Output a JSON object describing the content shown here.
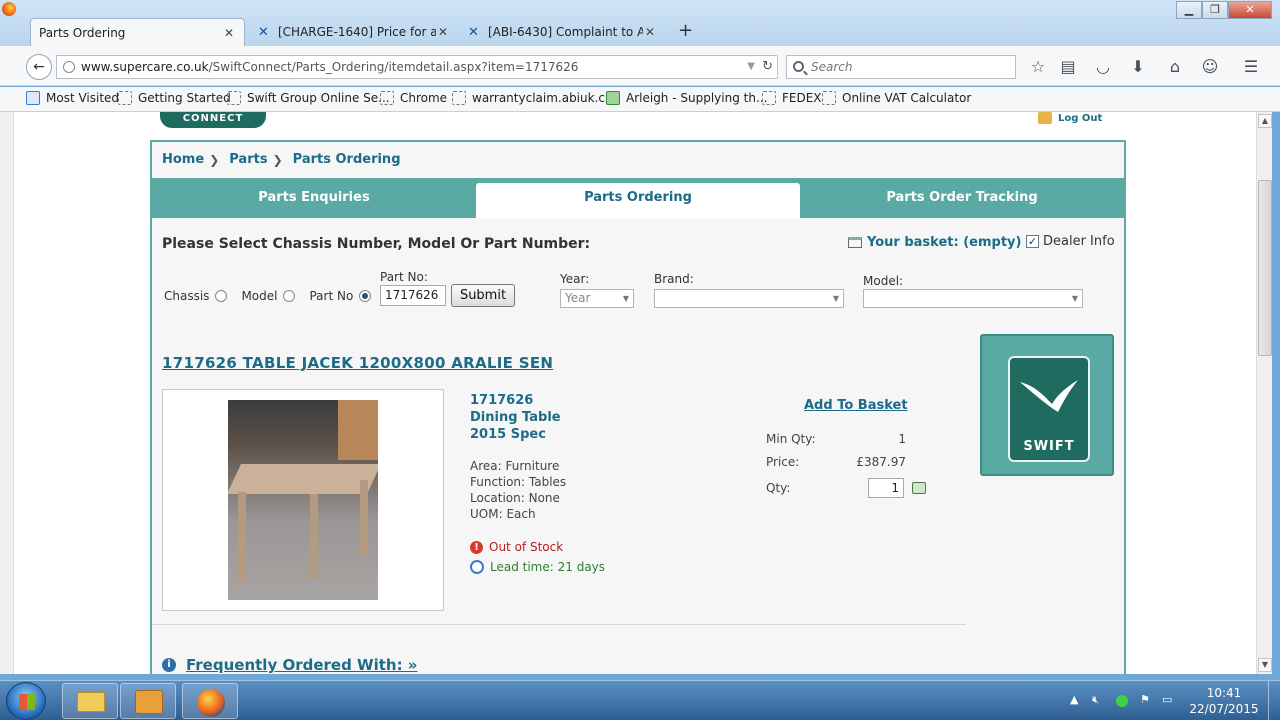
{
  "browser": {
    "tabs": [
      {
        "label": "Parts Ordering",
        "active": true
      },
      {
        "label": "[CHARGE-1640] Price for a ..."
      },
      {
        "label": "[ABI-6430] Complaint to A..."
      }
    ],
    "url_host": "www.supercare.co.uk",
    "url_path": "/SwiftConnect/Parts_Ordering/itemdetail.aspx?item=1717626",
    "search_placeholder": "Search",
    "bookmarks": [
      "Most Visited",
      "Getting Started",
      "Swift Group Online Se...",
      "Chrome",
      "warrantyclaim.abiuk.c...",
      "Arleigh - Supplying th...",
      "FEDEX",
      "Online VAT Calculator"
    ]
  },
  "site": {
    "logo_text": "CONNECT",
    "logout": "Log Out",
    "breadcrumb": [
      "Home",
      "Parts",
      "Parts Ordering"
    ],
    "tabs": [
      "Parts Enquiries",
      "Parts Ordering",
      "Parts Order Tracking"
    ],
    "select_title": "Please Select Chassis Number, Model Or Part Number:",
    "basket": "Your basket: (empty)",
    "dealer_info": "Dealer Info",
    "dealer_checked": true,
    "radios": [
      "Chassis",
      "Model",
      "Part No"
    ],
    "radio_selected": "Part No",
    "part_no_label": "Part No:",
    "part_no_value": "1717626",
    "submit": "Submit",
    "year_label": "Year:",
    "year_value": "Year",
    "brand_label": "Brand:",
    "model_label": "Model:"
  },
  "product": {
    "title": "1717626 TABLE JACEK 1200X800 ARALIE SEN",
    "code": "1717626",
    "name": "Dining Table",
    "spec": "2015 Spec",
    "area": "Area: Furniture",
    "function": "Function: Tables",
    "location": "Location: None",
    "uom": "UOM: Each",
    "stock": "Out of Stock",
    "lead_time": "Lead time: 21 days",
    "add_to_basket": "Add To Basket",
    "min_qty_label": "Min Qty:",
    "min_qty": "1",
    "price_label": "Price:",
    "price": "£387.97",
    "qty_label": "Qty:",
    "qty": "1",
    "brand_logo": "SWIFT"
  },
  "related": {
    "title": "Frequently Ordered With: »"
  },
  "taskbar": {
    "time": "10:41",
    "date": "22/07/2015"
  }
}
